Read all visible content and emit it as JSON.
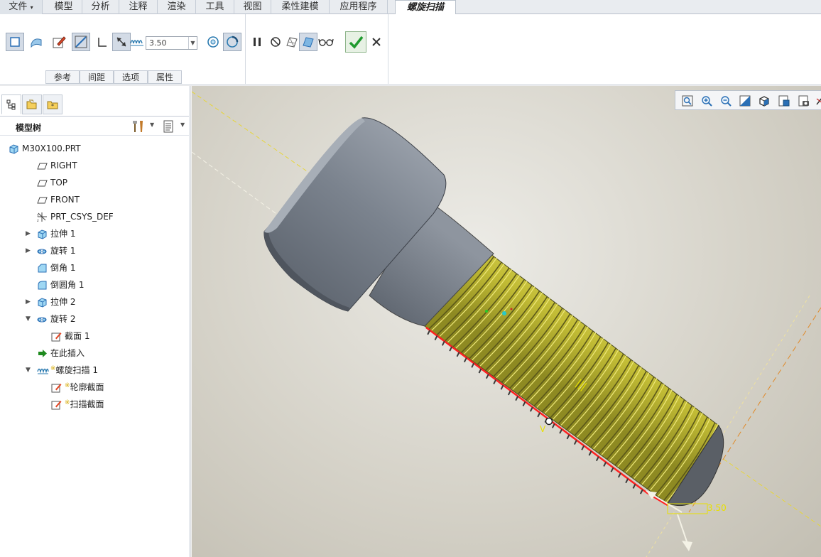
{
  "menubar": {
    "file": "文件",
    "tabs": [
      "模型",
      "分析",
      "注释",
      "渲染",
      "工具",
      "视图",
      "柔性建模",
      "应用程序"
    ],
    "active_tab": "螺旋扫描"
  },
  "ribbon": {
    "pitch_value": "3.50",
    "subtabs": [
      "参考",
      "间距",
      "选项",
      "属性"
    ]
  },
  "panel": {
    "title": "模型树",
    "tree": [
      {
        "label": "M30X100.PRT",
        "icon": "part-icon",
        "indent": 0,
        "toggle": ""
      },
      {
        "label": "RIGHT",
        "icon": "datum-plane-icon",
        "indent": 1,
        "toggle": ""
      },
      {
        "label": "TOP",
        "icon": "datum-plane-icon",
        "indent": 1,
        "toggle": ""
      },
      {
        "label": "FRONT",
        "icon": "datum-plane-icon",
        "indent": 1,
        "toggle": ""
      },
      {
        "label": "PRT_CSYS_DEF",
        "icon": "csys-icon",
        "indent": 1,
        "toggle": ""
      },
      {
        "label": "拉伸 1",
        "icon": "extrude-icon",
        "indent": 1,
        "toggle": "collapsed"
      },
      {
        "label": "旋转 1",
        "icon": "revolve-icon",
        "indent": 1,
        "toggle": "collapsed"
      },
      {
        "label": "倒角 1",
        "icon": "chamfer-icon",
        "indent": 1,
        "toggle": ""
      },
      {
        "label": "倒圆角 1",
        "icon": "round-icon",
        "indent": 1,
        "toggle": ""
      },
      {
        "label": "拉伸 2",
        "icon": "extrude-icon",
        "indent": 1,
        "toggle": "collapsed"
      },
      {
        "label": "旋转 2",
        "icon": "revolve-icon",
        "indent": 1,
        "toggle": "expanded"
      },
      {
        "label": "截面 1",
        "icon": "sketch-icon",
        "indent": 2,
        "toggle": ""
      },
      {
        "label": "在此插入",
        "icon": "insert-here-icon",
        "indent": 1,
        "toggle": ""
      },
      {
        "label": "螺旋扫描 1",
        "icon": "helical-sweep-icon",
        "indent": 1,
        "toggle": "expanded",
        "new": true
      },
      {
        "label": "轮廓截面",
        "icon": "sketch-icon",
        "indent": 2,
        "toggle": "",
        "new": true
      },
      {
        "label": "扫描截面",
        "icon": "sketch-icon",
        "indent": 2,
        "toggle": "",
        "new": true
      }
    ]
  },
  "viewport": {
    "pitch_label": "3.50",
    "marker": "V"
  },
  "colors": {
    "thread": "#c8c23a",
    "bolt_body": "#7d8591",
    "highlight_edge": "#ff2020"
  }
}
